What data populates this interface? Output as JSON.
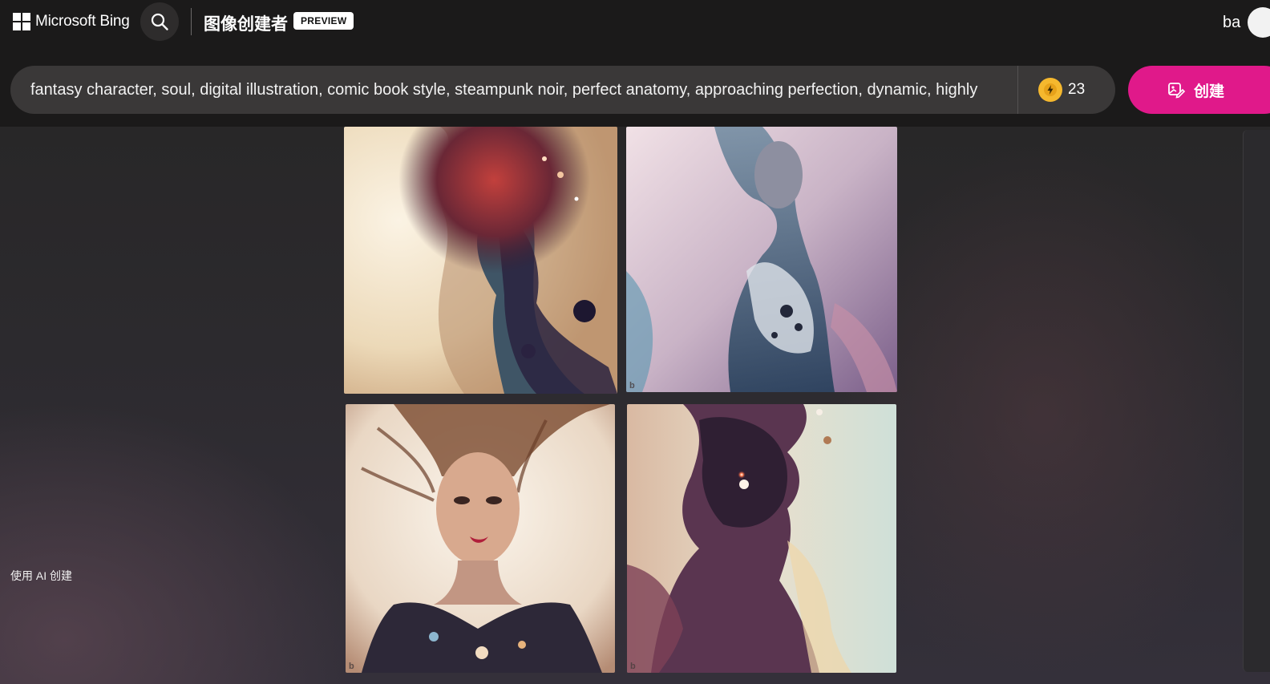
{
  "header": {
    "brand": "Microsoft Bing",
    "product_title": "图像创建者",
    "badge": "PREVIEW",
    "user_name": "ba"
  },
  "prompt": {
    "value": "fantasy character, soul, digital illustration, comic book style, steampunk noir, perfect anatomy, approaching perfection, dynamic, highly",
    "boost_count": "23",
    "create_label": "创建"
  },
  "sidebar": {
    "label": "使用 AI 创建"
  },
  "images": [
    {
      "alt": "generated-image-1"
    },
    {
      "alt": "generated-image-2"
    },
    {
      "alt": "generated-image-3"
    },
    {
      "alt": "generated-image-4"
    }
  ],
  "icons": {
    "logo": "windows-logo-icon",
    "search": "search-icon",
    "boost": "lightning-icon",
    "create": "create-icon"
  },
  "colors": {
    "create_button": "#e0198a",
    "boost": "#f5b82e",
    "header_bg": "#1b1a1a"
  }
}
